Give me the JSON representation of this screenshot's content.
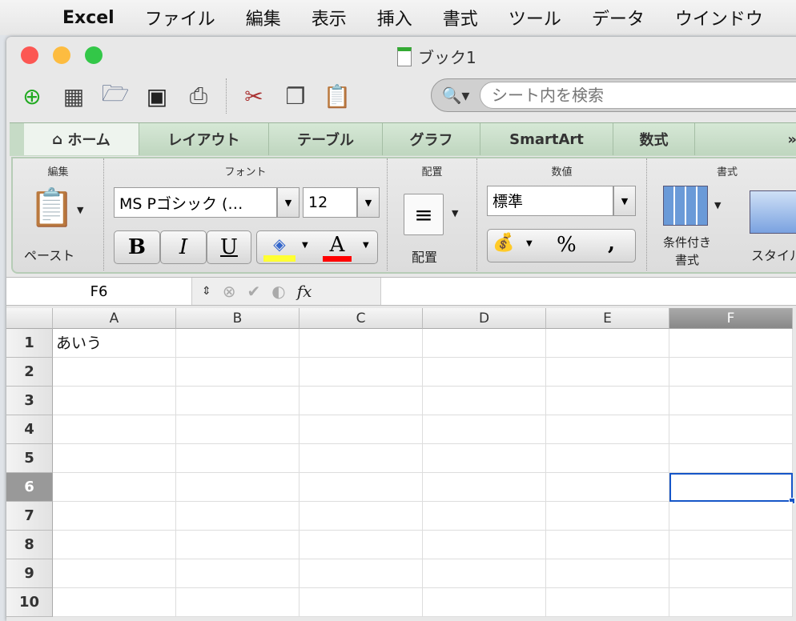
{
  "menubar": {
    "app": "Excel",
    "items": [
      "ファイル",
      "編集",
      "表示",
      "挿入",
      "書式",
      "ツール",
      "データ",
      "ウインドウ"
    ]
  },
  "window": {
    "title": "ブック1"
  },
  "search": {
    "placeholder": "シート内を検索"
  },
  "tabs": [
    "ホーム",
    "レイアウト",
    "テーブル",
    "グラフ",
    "SmartArt",
    "数式",
    "»"
  ],
  "ribbon": {
    "groups": {
      "edit": "編集",
      "font": "フォント",
      "align": "配置",
      "number": "数値",
      "format": "書式"
    },
    "paste_label": "ペースト",
    "font_name": "MS Pゴシック (…",
    "font_size": "12",
    "bold": "B",
    "italic": "I",
    "underline": "U",
    "font_color": "A",
    "align_label": "配置",
    "number_format": "標準",
    "percent": "%",
    "comma": ",",
    "conditional_format": "条件付き\n書式",
    "cond1": "条件付き",
    "cond2": "書式",
    "styles": "スタイル",
    "colors": {
      "fill": "#ffff33",
      "font": "#ff0000"
    }
  },
  "formula_bar": {
    "name_box": "F6",
    "fx": "fx",
    "value": ""
  },
  "sheet": {
    "columns": [
      "A",
      "B",
      "C",
      "D",
      "E",
      "F"
    ],
    "rows": [
      "1",
      "2",
      "3",
      "4",
      "5",
      "6",
      "7",
      "8",
      "9",
      "10"
    ],
    "cells": {
      "A1": "あいう"
    },
    "active_cell": "F6"
  }
}
